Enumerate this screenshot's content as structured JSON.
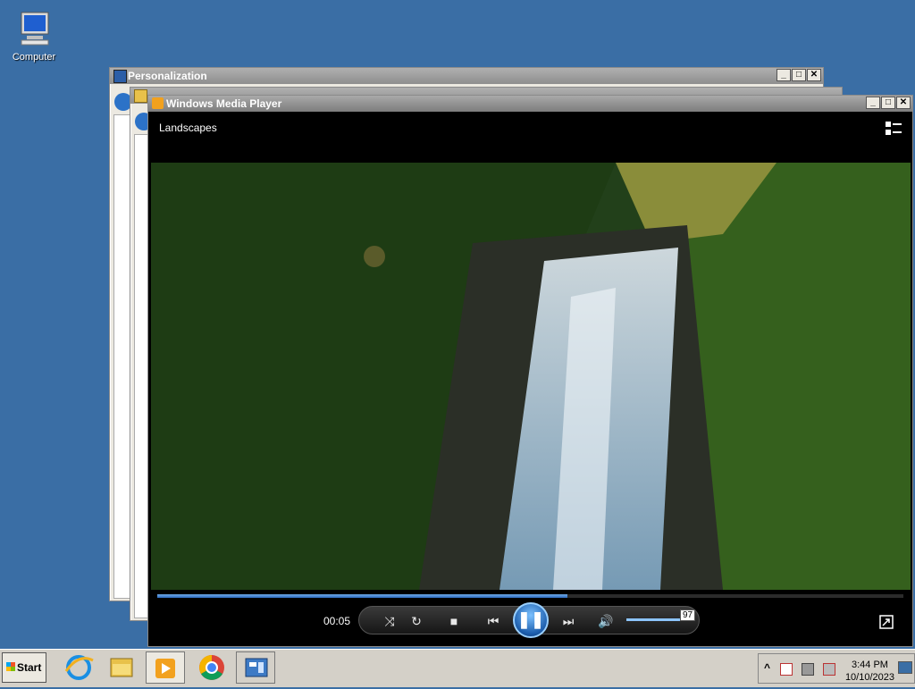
{
  "desktop": {
    "icons": [
      {
        "label": "Computer",
        "icon": "computer-icon"
      }
    ]
  },
  "windows": {
    "personalization": {
      "title": "Personalization"
    },
    "media_player": {
      "title": "Windows Media Player",
      "now_playing": "Landscapes",
      "elapsed": "00:05",
      "seek_progress": 0.55,
      "volume": 97,
      "volume_tip": "97"
    }
  },
  "window_controls": {
    "minimize": "_",
    "maximize": "□",
    "close": "✕"
  },
  "taskbar": {
    "start_label": "Start",
    "pinned": [
      "internet-explorer-icon",
      "file-explorer-icon",
      "windows-media-player-icon",
      "chrome-icon",
      "server-manager-icon"
    ],
    "tray_expand": "^",
    "clock_time": "3:44 PM",
    "clock_date": "10/10/2023"
  },
  "colors": {
    "desktop": "#3a6ea5",
    "accent": "#2d6bc0"
  }
}
